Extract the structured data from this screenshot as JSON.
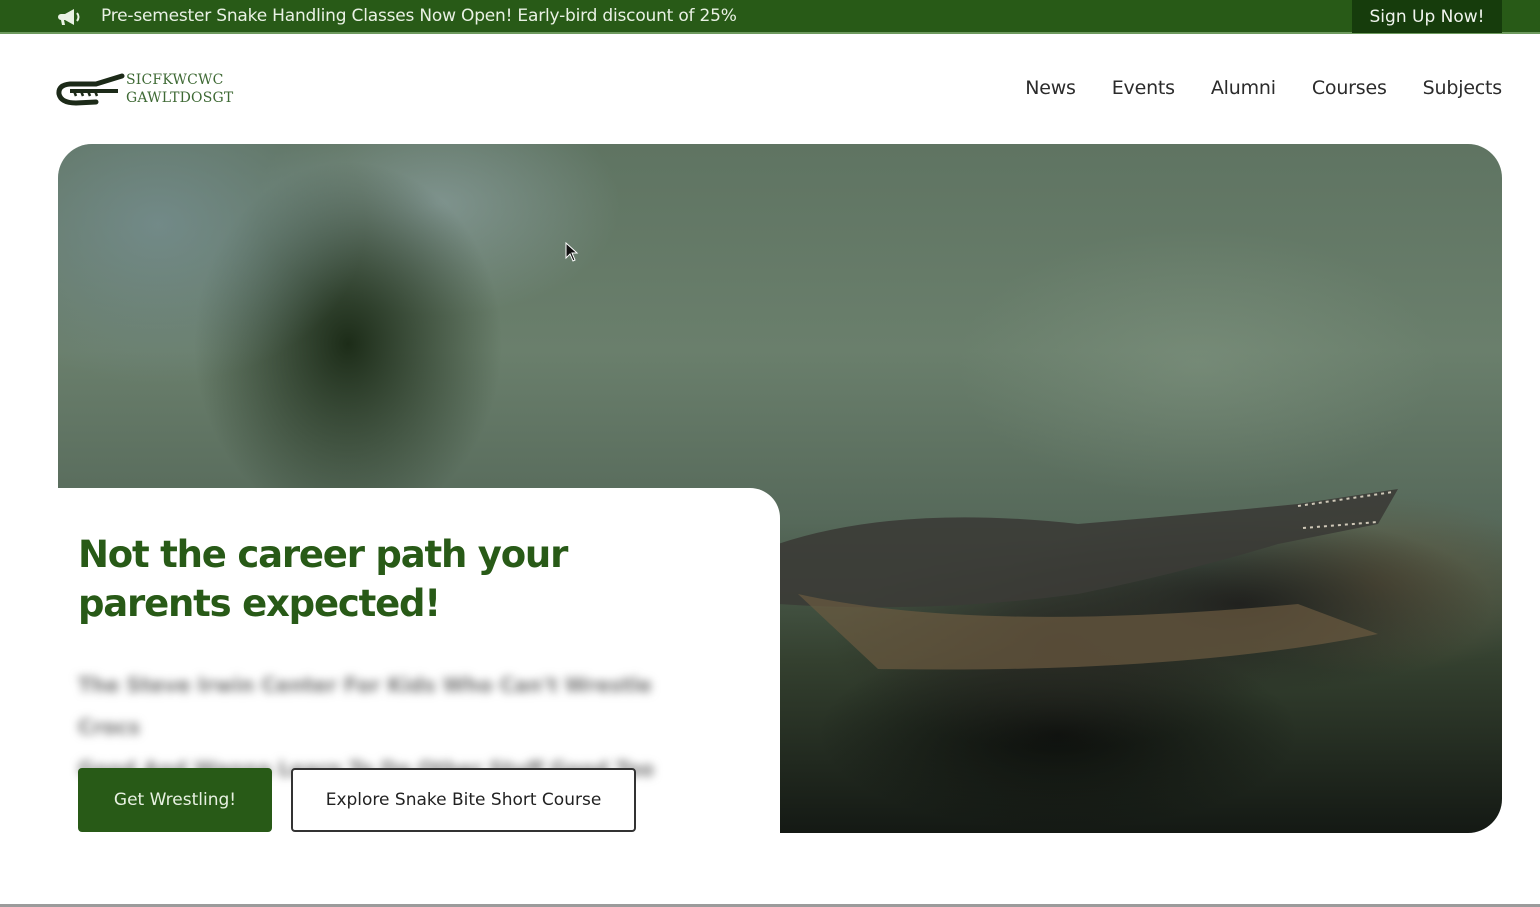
{
  "announcement": {
    "icon": "megaphone-icon",
    "message": "Pre-semester Snake Handling Classes Now Open! Early-bird discount of 25%",
    "cta_label": "Sign Up Now!"
  },
  "brand": {
    "logo_icon": "crocodile-logo-icon",
    "line1": "SICFKWCWC",
    "line2": "GAWLTDOSGT"
  },
  "nav": {
    "items": [
      {
        "label": "News"
      },
      {
        "label": "Events"
      },
      {
        "label": "Alumni"
      },
      {
        "label": "Courses"
      },
      {
        "label": "Subjects"
      }
    ]
  },
  "hero": {
    "image_alt": "Crocodile basking on a rock by water in a jungle enclosure",
    "headline_line1": "Not the career path your",
    "headline_line2": "parents expected!",
    "subtitle_line1": "The Steve Irwin Center For Kids Who Can't Wrestle Crocs",
    "subtitle_line2": "Good And Wanna Learn To Do Other Stuff Good Too",
    "primary_button": "Get Wrestling!",
    "secondary_button": "Explore Snake Bite Short Course"
  },
  "colors": {
    "brand_green": "#285a17",
    "announce_cta_bg": "#163c0c"
  }
}
